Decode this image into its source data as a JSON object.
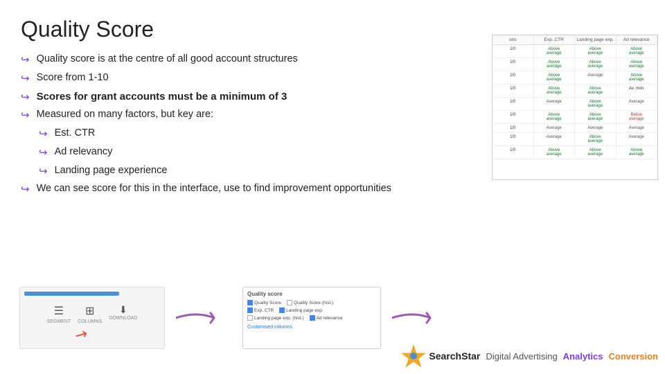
{
  "title": "Quality Score",
  "bullets": [
    {
      "text": "Quality score is at the centre of all good account structures",
      "bold": false,
      "sub": false
    },
    {
      "text": "Score from 1-10",
      "bold": false,
      "sub": false
    },
    {
      "text": "Scores for grant accounts must be a minimum of 3",
      "bold": true,
      "sub": false
    },
    {
      "text": "Measured on many factors, but key are:",
      "bold": false,
      "sub": false
    },
    {
      "text": "Est. CTR",
      "bold": false,
      "sub": true
    },
    {
      "text": "Ad relevancy",
      "bold": false,
      "sub": true
    },
    {
      "text": "Landing page experience",
      "bold": false,
      "sub": true
    },
    {
      "text": "We can see score for this in the interface, use to find improvement opportunities",
      "bold": false,
      "sub": false
    }
  ],
  "columns_dialog": {
    "title": "Quality score",
    "checkboxes": [
      {
        "label": "Quality Score",
        "checked": true
      },
      {
        "label": "Quality Score (hist.)",
        "checked": false
      },
      {
        "label": "Exp. CTR",
        "checked": true
      },
      {
        "label": "Landing page exp.",
        "checked": true
      },
      {
        "label": "Landing page exp. (hist.)",
        "checked": false
      },
      {
        "label": "Ad relevance",
        "checked": true
      }
    ],
    "custom": "Customised columns"
  },
  "table": {
    "headers": [
      "ons",
      "Exp. CTR",
      "Landing page exp.",
      "Ad relevance"
    ],
    "rows": [
      [
        "1/0",
        "Above average",
        "Above average",
        "Above average"
      ],
      [
        "1/0",
        "Above average",
        "Above average",
        "Above average"
      ],
      [
        "1/0",
        "Above average",
        "Average",
        "Above average"
      ],
      [
        "1/0",
        "Above average",
        "Above average",
        "Av. mon"
      ],
      [
        "1/0",
        "Average",
        "Above average",
        "Average"
      ],
      [
        "1/0",
        "Above average",
        "Above average",
        "Below average"
      ],
      [
        "1/0",
        "Average",
        "Average",
        "Average"
      ],
      [
        "1/0",
        "Average",
        "Above average",
        "Average"
      ],
      [
        "1/0",
        "Above average",
        "Above average",
        "Above average"
      ]
    ]
  },
  "footer": {
    "logo_text": "SearchStar",
    "links": [
      {
        "text": "Digital Advertising",
        "color": "#555555"
      },
      {
        "text": "Analytics",
        "color": "#7c3aed"
      },
      {
        "text": "Conversion",
        "color": "#e67e22"
      }
    ]
  },
  "icons": {
    "segment": "☰",
    "columns": "▦",
    "download": "⬇",
    "arrow": "▶"
  }
}
